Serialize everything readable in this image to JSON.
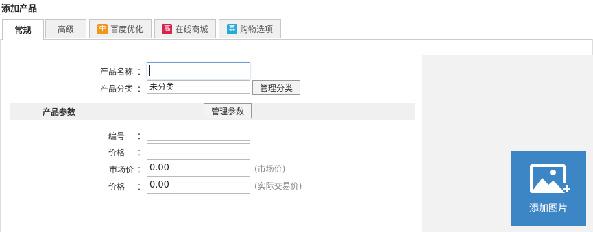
{
  "page_title": "添加产品",
  "tabs": [
    {
      "label": "常规",
      "badge": ""
    },
    {
      "label": "高级",
      "badge": ""
    },
    {
      "label": "百度优化",
      "badge": "中",
      "badge_color": "#f0971f"
    },
    {
      "label": "在线商城",
      "badge": "高",
      "badge_color": "#d6244a"
    },
    {
      "label": "购物选项",
      "badge": "尊",
      "badge_color": "#28a9d7"
    }
  ],
  "form": {
    "name_label": "产品名称",
    "name_value": "",
    "category_label": "产品分类",
    "category_value": "未分类",
    "manage_category": "管理分类",
    "colon": "："
  },
  "params": {
    "title": "产品参数",
    "manage_params": "管理参数",
    "code_label": "编号",
    "price_label": "价格",
    "market_price_label": "市场价",
    "market_price_value": "0.00",
    "market_price_hint": "(市场价)",
    "real_price_label": "价格",
    "real_price_value": "0.00",
    "real_price_hint": "(实际交易价)"
  },
  "image": {
    "add_label": "添加图片",
    "icon": "add-image-icon"
  },
  "colors": {
    "accent": "#3d86c6",
    "focus_border": "#6f9bd8"
  }
}
